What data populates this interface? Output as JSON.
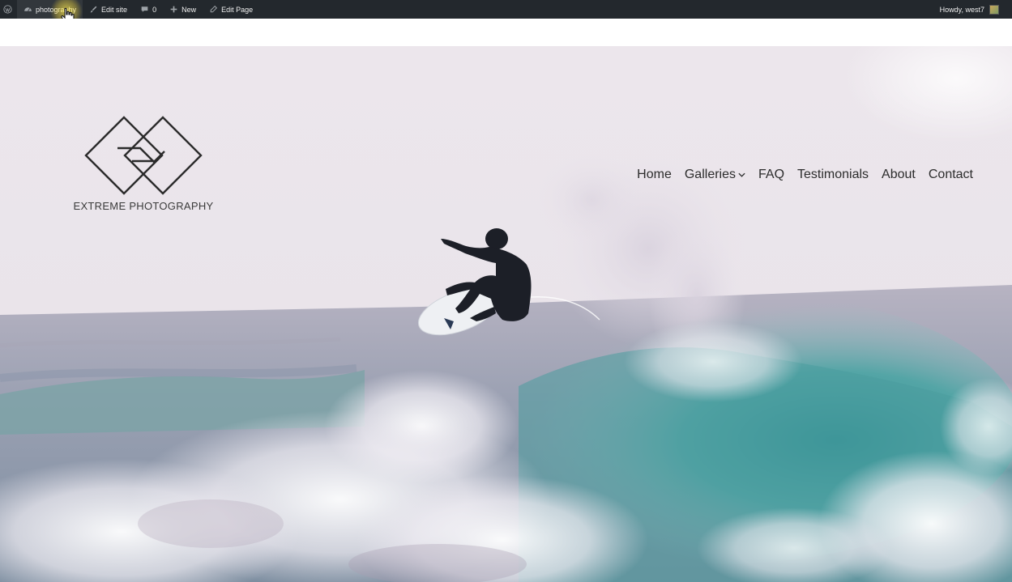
{
  "admin_bar": {
    "wp_logo_icon": "wordpress-icon",
    "site_label": "photography",
    "site_icon": "dashboard-icon",
    "customize_label": "Edit site",
    "customize_icon": "brush-icon",
    "comments_count": "0",
    "comments_icon": "comment-icon",
    "new_label": "New",
    "new_icon": "plus-icon",
    "edit_label": "Edit Page",
    "edit_icon": "pencil-icon",
    "greeting": "Howdy, west7",
    "background": "#23282d"
  },
  "logo": {
    "text": "EXTREME PHOTOGRAPHY",
    "mark": "interlocking-diamonds"
  },
  "nav": {
    "items": [
      {
        "label": "Home",
        "has_dropdown": false
      },
      {
        "label": "Galleries",
        "has_dropdown": true
      },
      {
        "label": "FAQ",
        "has_dropdown": false
      },
      {
        "label": "Testimonials",
        "has_dropdown": false
      },
      {
        "label": "About",
        "has_dropdown": false
      },
      {
        "label": "Contact",
        "has_dropdown": false
      }
    ]
  },
  "hero": {
    "image": "surfer-aerial-over-breaking-wave",
    "sky_color": "#ebe4ea",
    "sea_color": "#7ea4aa"
  }
}
